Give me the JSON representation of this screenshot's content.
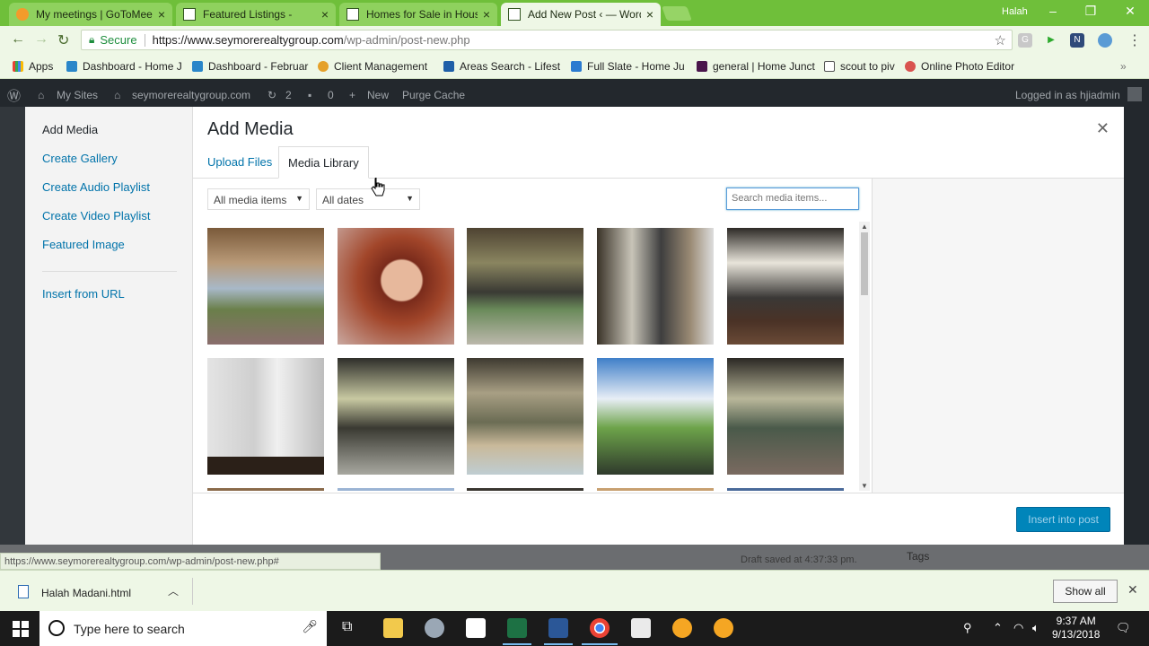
{
  "browser": {
    "tabs": [
      {
        "title": "My meetings | GoToMeeting",
        "active": false
      },
      {
        "title": "Featured Listings -",
        "active": false
      },
      {
        "title": "Homes for Sale in Houston",
        "active": false
      },
      {
        "title": "Add New Post ‹ — WordPress",
        "active": true
      }
    ],
    "profile": "Halah",
    "secure_label": "Secure",
    "url_host": "https://www.seymorerealtygroup.com",
    "url_path": "/wp-admin/post-new.php",
    "bookmarks": [
      "Apps",
      "Dashboard - Home J",
      "Dashboard - Februar",
      "Client Management",
      "Areas Search - Lifest",
      "Full Slate - Home Ju",
      "general | Home Junct",
      "scout to piv",
      "Online Photo Editor"
    ],
    "status_url": "https://www.seymorerealtygroup.com/wp-admin/post-new.php#",
    "colors": {
      "chrome": "#6fbf3a",
      "wp_admin": "#23282d",
      "wp_link": "#0073aa",
      "primary_button": "#0085ba"
    }
  },
  "wp_admin_bar": {
    "my_sites": "My Sites",
    "site": "seymorerealtygroup.com",
    "updates": "2",
    "comments": "0",
    "new": "New",
    "purge": "Purge Cache",
    "logged_in": "Logged in as hjiadmin"
  },
  "underpage": {
    "draft_saved": "Draft saved at 4:37:33 pm.",
    "tags": "Tags"
  },
  "media_modal": {
    "title": "Add Media",
    "menu": [
      "Add Media",
      "Create Gallery",
      "Create Audio Playlist",
      "Create Video Playlist",
      "Featured Image",
      "Insert from URL"
    ],
    "tabs": [
      "Upload Files",
      "Media Library"
    ],
    "filter_type": "All media items",
    "filter_date": "All dates",
    "search_placeholder": "Search media items...",
    "insert_label": "Insert into post",
    "close_icon": "close-icon"
  },
  "downloads": {
    "file": "Halah Madani.html",
    "show_all": "Show all"
  },
  "taskbar": {
    "search_placeholder": "Type here to search",
    "time": "9:37 AM",
    "date": "9/13/2018"
  }
}
